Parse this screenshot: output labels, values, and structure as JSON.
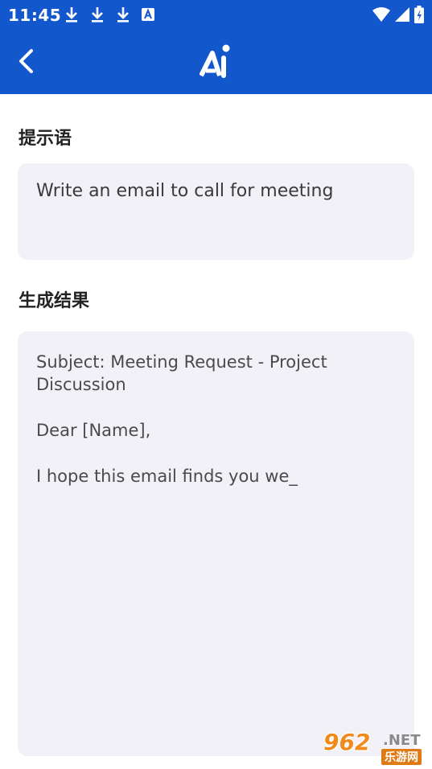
{
  "status_bar": {
    "time": "11:45",
    "left_icons": [
      "download-icon",
      "download-icon",
      "download-icon",
      "accessibility-a-icon"
    ],
    "right_icons": [
      "wifi-icon",
      "cell-signal-icon",
      "battery-icon"
    ]
  },
  "app_bar": {
    "back_icon": "back-arrow-icon",
    "logo_icon": "ai-logo-icon",
    "background": "#1257cc"
  },
  "prompt_section": {
    "label": "提示语",
    "value": "Write an email to call for meeting"
  },
  "result_section": {
    "label": "生成结果",
    "paragraphs": [
      "Subject: Meeting Request - Project Discussion",
      "Dear [Name],",
      "I hope this email finds you we_"
    ]
  },
  "watermark": {
    "main": "962",
    "net": ".NET",
    "sub": "乐游网"
  },
  "colors": {
    "accent": "#1257cc",
    "box_background": "#f2f1f7",
    "label_text": "#222222",
    "body_text": "#4a4a4a"
  }
}
